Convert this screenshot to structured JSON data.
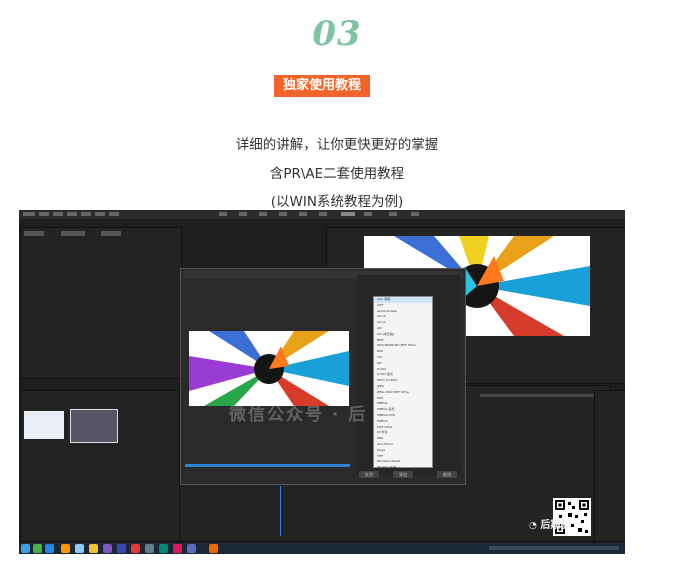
{
  "header": {
    "step_number": "03",
    "badge": "独家使用教程"
  },
  "description": [
    "详细的讲解，让你更快更好的掌握",
    "含PR\\AE二套使用教程",
    "(以WIN系统教程为例)"
  ],
  "screenshot": {
    "watermark": "微信公众号 · 后",
    "wechat_label": "后期圈",
    "dropdown_items": [
      "AAC 音频",
      "AIFF",
      "Apple ProRes",
      "AS-10",
      "AS-11",
      "AVI",
      "AVI (未压缩)",
      "BMP",
      "DNxHR/DNxHD MXF OP1a",
      "DPX",
      "FLV",
      "GIF",
      "H.264",
      "H.264 蓝光",
      "HEVC (H.265)",
      "JPEG",
      "JPEG 2000 MXF OP1a",
      "MP3",
      "MPEG2",
      "MPEG2 蓝光",
      "MPEG2-DVD",
      "MPEG4",
      "MXF OP1a",
      "P2 影片",
      "PNG",
      "QuickTime",
      "Targa",
      "TIFF",
      "Windows Media",
      "Wraptor DCP",
      "波形音频",
      "动画 GIF"
    ],
    "dialog_buttons": [
      "队列",
      "导出",
      "取消"
    ],
    "colors": {
      "accent_badge": "#f2652a",
      "step_number": "#7dc4a5"
    }
  }
}
